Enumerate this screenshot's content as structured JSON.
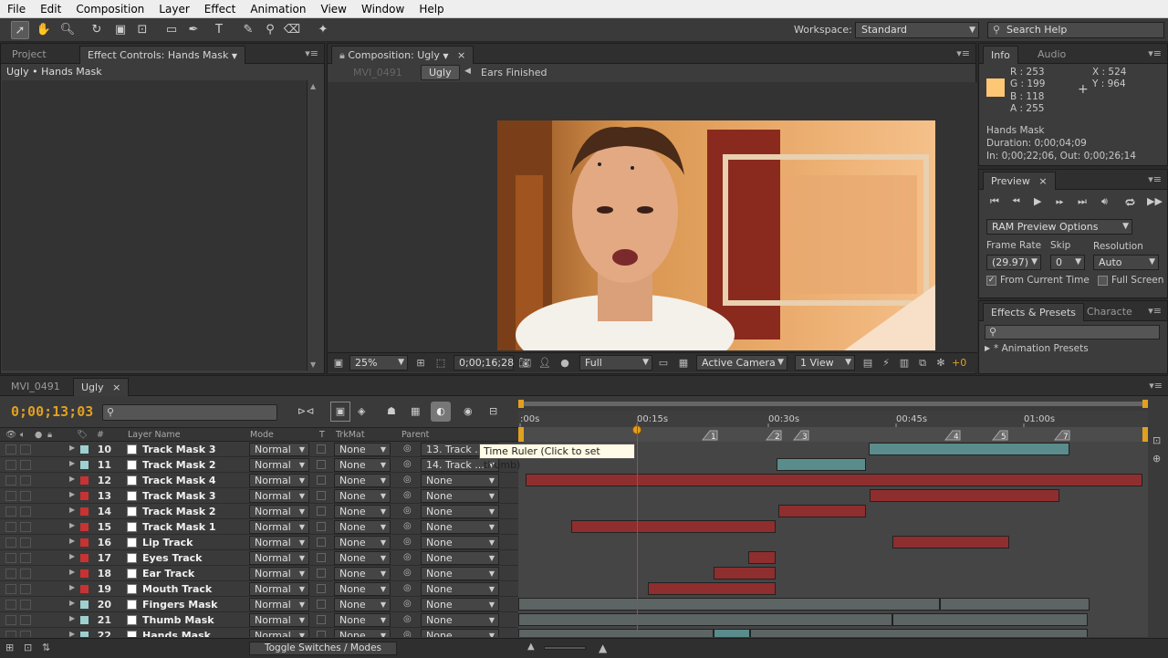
{
  "menu": [
    "File",
    "Edit",
    "Composition",
    "Layer",
    "Effect",
    "Animation",
    "View",
    "Window",
    "Help"
  ],
  "toolbar": {
    "workspace_label": "Workspace:",
    "workspace_value": "Standard",
    "search_help": "Search Help"
  },
  "effect_panel": {
    "tab_project": "Project",
    "tab_effect": "Effect Controls: Hands Mask",
    "breadcrumb": "Ugly • Hands Mask"
  },
  "comp_panel": {
    "tab": "Composition: Ugly",
    "crumb_prev": "MVI_0491",
    "crumb_current": "Ugly",
    "crumb_next": "Ears Finished",
    "zoom": "25%",
    "timecode": "0;00;16;28",
    "resolution": "Full",
    "camera": "Active Camera",
    "views": "1 View",
    "exposure": "+0"
  },
  "info_panel": {
    "tab_info": "Info",
    "tab_audio": "Audio",
    "color_hex": "#FDC776",
    "r": "R : 253",
    "g": "G : 199",
    "b": "B : 118",
    "a": "A : 255",
    "x": "X : 524",
    "y": "Y : 964",
    "layer_name": "Hands Mask",
    "duration": "Duration: 0;00;04;09",
    "in_out": "In: 0;00;22;06, Out: 0;00;26;14"
  },
  "preview_panel": {
    "tab": "Preview",
    "ram_options": "RAM Preview Options",
    "frame_rate_label": "Frame Rate",
    "skip_label": "Skip",
    "resolution_label": "Resolution",
    "frame_rate_value": "(29.97)",
    "skip_value": "0",
    "resolution_value": "Auto",
    "from_current": "From Current Time",
    "full_screen": "Full Screen"
  },
  "effects_panel": {
    "tab_effects": "Effects & Presets",
    "tab_character": "Characte",
    "animation_presets": "* Animation Presets"
  },
  "timeline": {
    "tab_mvi": "MVI_0491",
    "tab_ugly": "Ugly",
    "timecode": "0;00;13;03",
    "col_hash": "#",
    "col_layer_name": "Layer Name",
    "col_mode": "Mode",
    "col_t": "T",
    "col_trkmat": "TrkMat",
    "col_parent": "Parent",
    "ruler_labels": [
      ":00s",
      "00:15s",
      "00:30s",
      "00:45s",
      "01:00s"
    ],
    "markers": [
      "1",
      "2",
      "3",
      "4",
      "5",
      "7"
    ],
    "toggle_label": "Toggle Switches / Modes",
    "tooltip": "Time Ruler (Click to set thumb)",
    "layers": [
      {
        "num": "10",
        "name": "Track Mask 3",
        "mode": "Normal",
        "trkmat": "None",
        "parent": "13. Track ...",
        "color": "#9fd0d0",
        "icon": "solid-mask"
      },
      {
        "num": "11",
        "name": "Track Mask 2",
        "mode": "Normal",
        "trkmat": "None",
        "parent": "14. Track ...",
        "color": "#9fd0d0",
        "icon": "solid-mask"
      },
      {
        "num": "12",
        "name": "Track Mask 4",
        "mode": "Normal",
        "trkmat": "None",
        "parent": "None",
        "color": "#c83232",
        "icon": "solid"
      },
      {
        "num": "13",
        "name": "Track Mask 3",
        "mode": "Normal",
        "trkmat": "None",
        "parent": "None",
        "color": "#c83232",
        "icon": "solid"
      },
      {
        "num": "14",
        "name": "Track Mask 2",
        "mode": "Normal",
        "trkmat": "None",
        "parent": "None",
        "color": "#c83232",
        "icon": "solid"
      },
      {
        "num": "15",
        "name": "Track Mask 1",
        "mode": "Normal",
        "trkmat": "None",
        "parent": "None",
        "color": "#c83232",
        "icon": "solid"
      },
      {
        "num": "16",
        "name": "Lip Track",
        "mode": "Normal",
        "trkmat": "None",
        "parent": "None",
        "color": "#c83232",
        "icon": "solid"
      },
      {
        "num": "17",
        "name": "Eyes Track",
        "mode": "Normal",
        "trkmat": "None",
        "parent": "None",
        "color": "#c83232",
        "icon": "solid"
      },
      {
        "num": "18",
        "name": "Ear Track",
        "mode": "Normal",
        "trkmat": "None",
        "parent": "None",
        "color": "#c83232",
        "icon": "solid"
      },
      {
        "num": "19",
        "name": "Mouth Track",
        "mode": "Normal",
        "trkmat": "None",
        "parent": "None",
        "color": "#c83232",
        "icon": "solid"
      },
      {
        "num": "20",
        "name": "Fingers Mask",
        "mode": "Normal",
        "trkmat": "None",
        "parent": "None",
        "color": "#9fd0d0",
        "icon": "solid-mask"
      },
      {
        "num": "21",
        "name": "Thumb Mask",
        "mode": "Normal",
        "trkmat": "None",
        "parent": "None",
        "color": "#9fd0d0",
        "icon": "solid-mask"
      },
      {
        "num": "22",
        "name": "Hands Mask",
        "mode": "Normal",
        "trkmat": "None",
        "parent": "None",
        "color": "#9fd0d0",
        "icon": "solid-mask"
      }
    ]
  }
}
